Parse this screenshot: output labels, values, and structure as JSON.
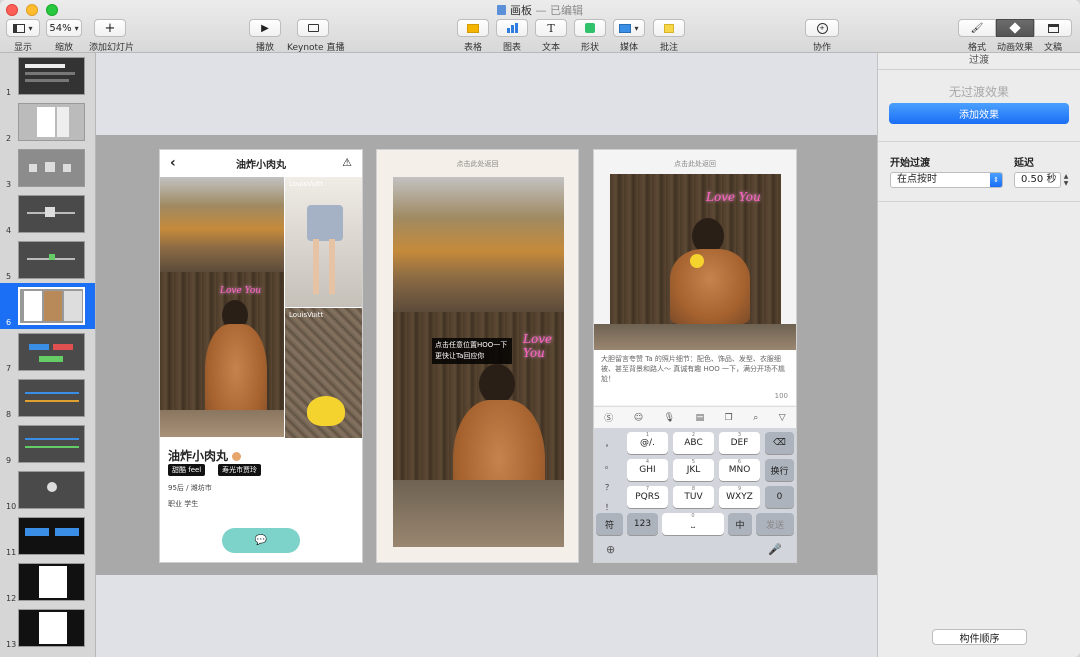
{
  "window": {
    "title": "画板",
    "edited": "— 已编辑"
  },
  "toolbar": {
    "view": "显示",
    "zoom_value": "54%",
    "zoom": "缩放",
    "add_slide": "添加幻灯片",
    "play": "播放",
    "keynote_live": "Keynote 直播",
    "table": "表格",
    "chart": "图表",
    "text": "文本",
    "shape": "形状",
    "media": "媒体",
    "comment": "批注",
    "collaborate": "协作",
    "format": "格式",
    "animate": "动画效果",
    "document": "文稿"
  },
  "navigator": {
    "slides": [
      "1",
      "2",
      "3",
      "4",
      "5",
      "6",
      "7",
      "8",
      "9",
      "10",
      "11",
      "12",
      "13"
    ],
    "selected": "6"
  },
  "slide": {
    "screen1": {
      "title": "油炸小肉丸",
      "photo1_caption": "LouisVuitt",
      "photo2_caption": "LouisVuitt",
      "name": "油炸小肉丸",
      "tag1": "甜酷 feel",
      "tag2": "寿光市贾玲",
      "age_city": "95后 / 潍坊市",
      "job": "职业  学生",
      "chat_icon": "💬"
    },
    "screen2": {
      "hint": "点击此处返回",
      "bubble": "点击任意位置HOO一下 更快让Ta回应你",
      "neon": "Love You"
    },
    "screen3": {
      "hint": "点击此处返回",
      "neon": "Love You",
      "comment": "大胆留言夸赞 Ta 的照片细节：配色、饰品、发型、衣服细被、甚至背景和路人～ 真诚有趣 HOO 一下，满分开场不尴尬！",
      "count": "100",
      "keys": {
        "row1": [
          "@/.",
          "ABC",
          "DEF"
        ],
        "row2": [
          "GHI",
          "JKL",
          "MNO"
        ],
        "row3": [
          "PQRS",
          "TUV",
          "WXYZ"
        ],
        "side_left": [
          "，",
          "。",
          "？",
          "！"
        ],
        "delete": "⌫",
        "newline": "换行",
        "zero": "0",
        "symbol": "符",
        "num": "123",
        "space": "0",
        "lang": "中",
        "send": "发送",
        "sub_row1": [
          "1",
          "2",
          "3"
        ],
        "sub_row2": [
          "4",
          "5",
          "6"
        ],
        "sub_row3": [
          "7",
          "8",
          "9"
        ]
      }
    }
  },
  "inspector": {
    "tab": "过渡",
    "no_effect": "无过渡效果",
    "add_effect": "添加效果",
    "start_label": "开始过渡",
    "start_value": "在点按时",
    "delay_label": "延迟",
    "delay_value": "0.50 秒",
    "build_order": "构件顺序"
  },
  "colors": {
    "accent": "#1a6ef5",
    "selection": "#1b6ff5",
    "chat_button": "#7dd3c9",
    "neon": "#ff64c8"
  }
}
